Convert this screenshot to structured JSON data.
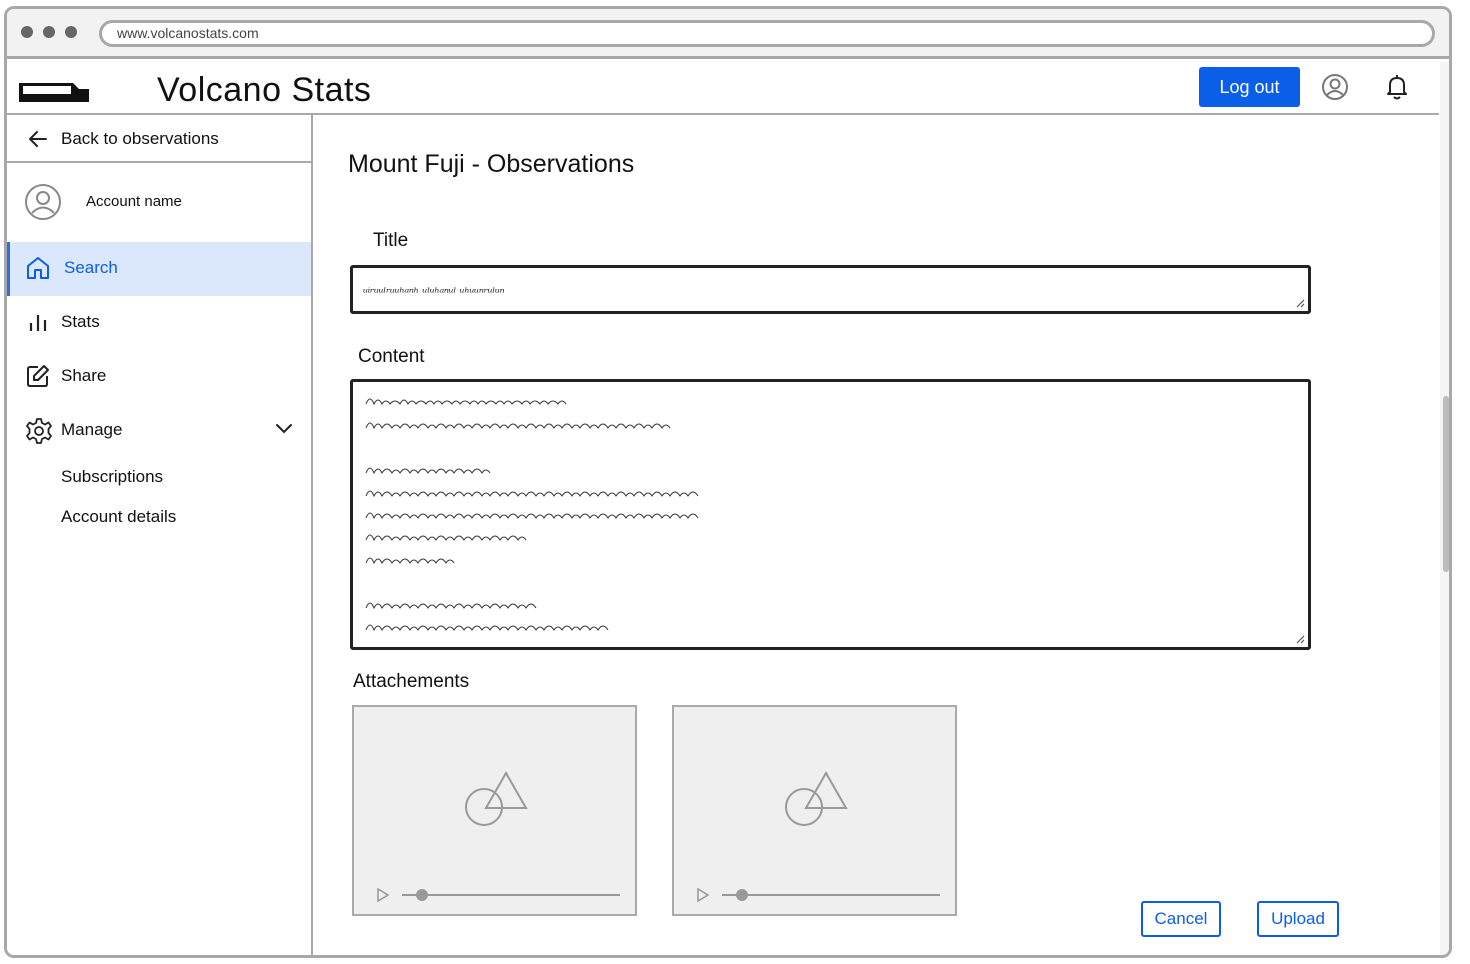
{
  "browser": {
    "url": "www.volcanostats.com"
  },
  "header": {
    "app_title": "Volcano Stats",
    "logout_label": "Log out"
  },
  "sidebar": {
    "back_label": "Back to observations",
    "account_name": "Account name",
    "items": [
      {
        "label": "Search",
        "icon": "home-icon",
        "active": true
      },
      {
        "label": "Stats",
        "icon": "bar-chart-icon",
        "active": false
      },
      {
        "label": "Share",
        "icon": "edit-icon",
        "active": false
      },
      {
        "label": "Manage",
        "icon": "gear-icon",
        "active": false,
        "expanded": true
      }
    ],
    "manage_subitems": [
      "Subscriptions",
      "Account details"
    ]
  },
  "main": {
    "page_title": "Mount Fuji - Observations",
    "title_label": "Title",
    "content_label": "Content",
    "attachments_label": "Attachements",
    "cancel_label": "Cancel",
    "upload_label": "Upload"
  },
  "colors": {
    "accent": "#0b5ee7",
    "active_nav_bg": "#dbe7fb",
    "border": "#a8a8a8"
  }
}
